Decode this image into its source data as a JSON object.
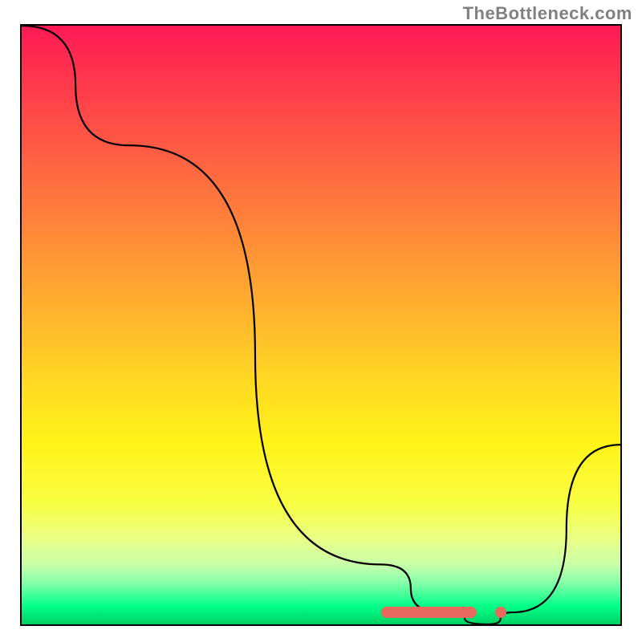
{
  "watermark": "TheBottleneck.com",
  "chart_data": {
    "type": "line",
    "title": "",
    "xlabel": "",
    "ylabel": "",
    "xlim": [
      0,
      100
    ],
    "ylim": [
      0,
      100
    ],
    "grid": false,
    "series": [
      {
        "name": "bottleneck-curve",
        "x": [
          0,
          18,
          60,
          70,
          78,
          82,
          100
        ],
        "values": [
          100,
          80,
          10,
          2,
          0,
          2,
          30
        ]
      }
    ],
    "annotations": [
      {
        "name": "optimal-band",
        "x_start": 60,
        "x_end": 76,
        "y": 2
      },
      {
        "name": "optimal-dot",
        "x": 80,
        "y": 2
      }
    ]
  }
}
